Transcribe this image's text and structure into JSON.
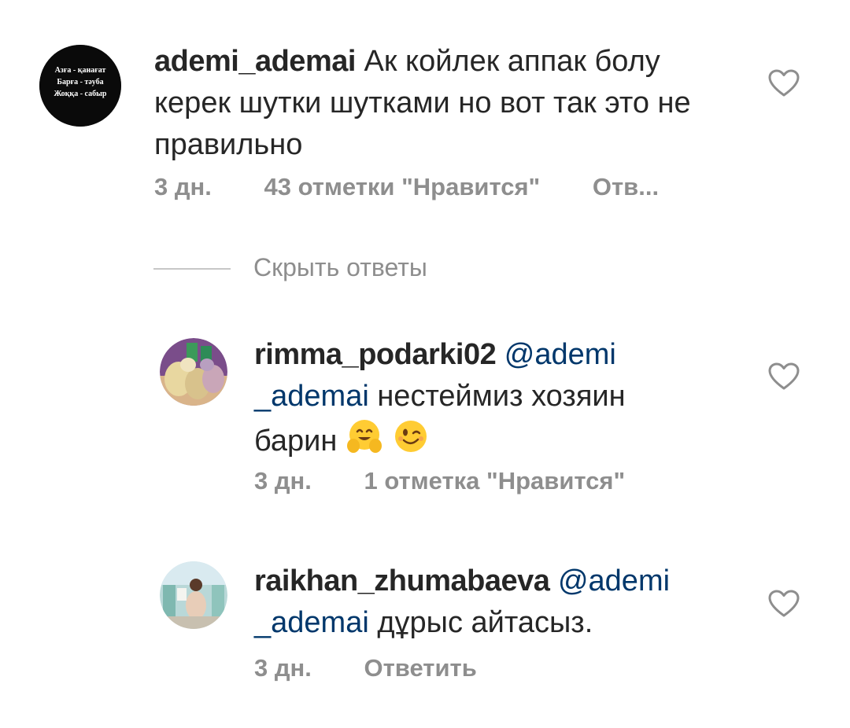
{
  "comments": [
    {
      "username": "ademi_ademai",
      "text": "Ак койлек аппак болу керек шутки шутками но  вот так это не правильно",
      "time": "3 дн.",
      "likes": "43 отметки \"Нравится\"",
      "reply": "Отв...",
      "avatar_lines": [
        "Азға - қанағат",
        "Барға - тәуба",
        "Жоққа - сабыр"
      ]
    }
  ],
  "hide_replies_label": "Скрыть ответы",
  "replies": [
    {
      "username": "rimma_podarki02",
      "mention_part1": "@ademi",
      "mention_part2": "_ademai",
      "text_line2": " нестеймиз хозяин",
      "text_line3": "барин ",
      "time": "3 дн.",
      "likes": "1 отметка \"Нравится\""
    },
    {
      "username": "raikhan_zhumabaeva",
      "mention_part1": "@ademi",
      "mention_part2": "_ademai",
      "text_line2": " дұрыс айтасыз.",
      "time": "3 дн.",
      "reply": "Ответить"
    }
  ],
  "colors": {
    "text": "#262626",
    "meta": "#8e8e8e",
    "mention": "#00376b"
  },
  "icons": [
    "heart-outline-icon",
    "hugging-face-emoji",
    "winking-face-emoji"
  ]
}
